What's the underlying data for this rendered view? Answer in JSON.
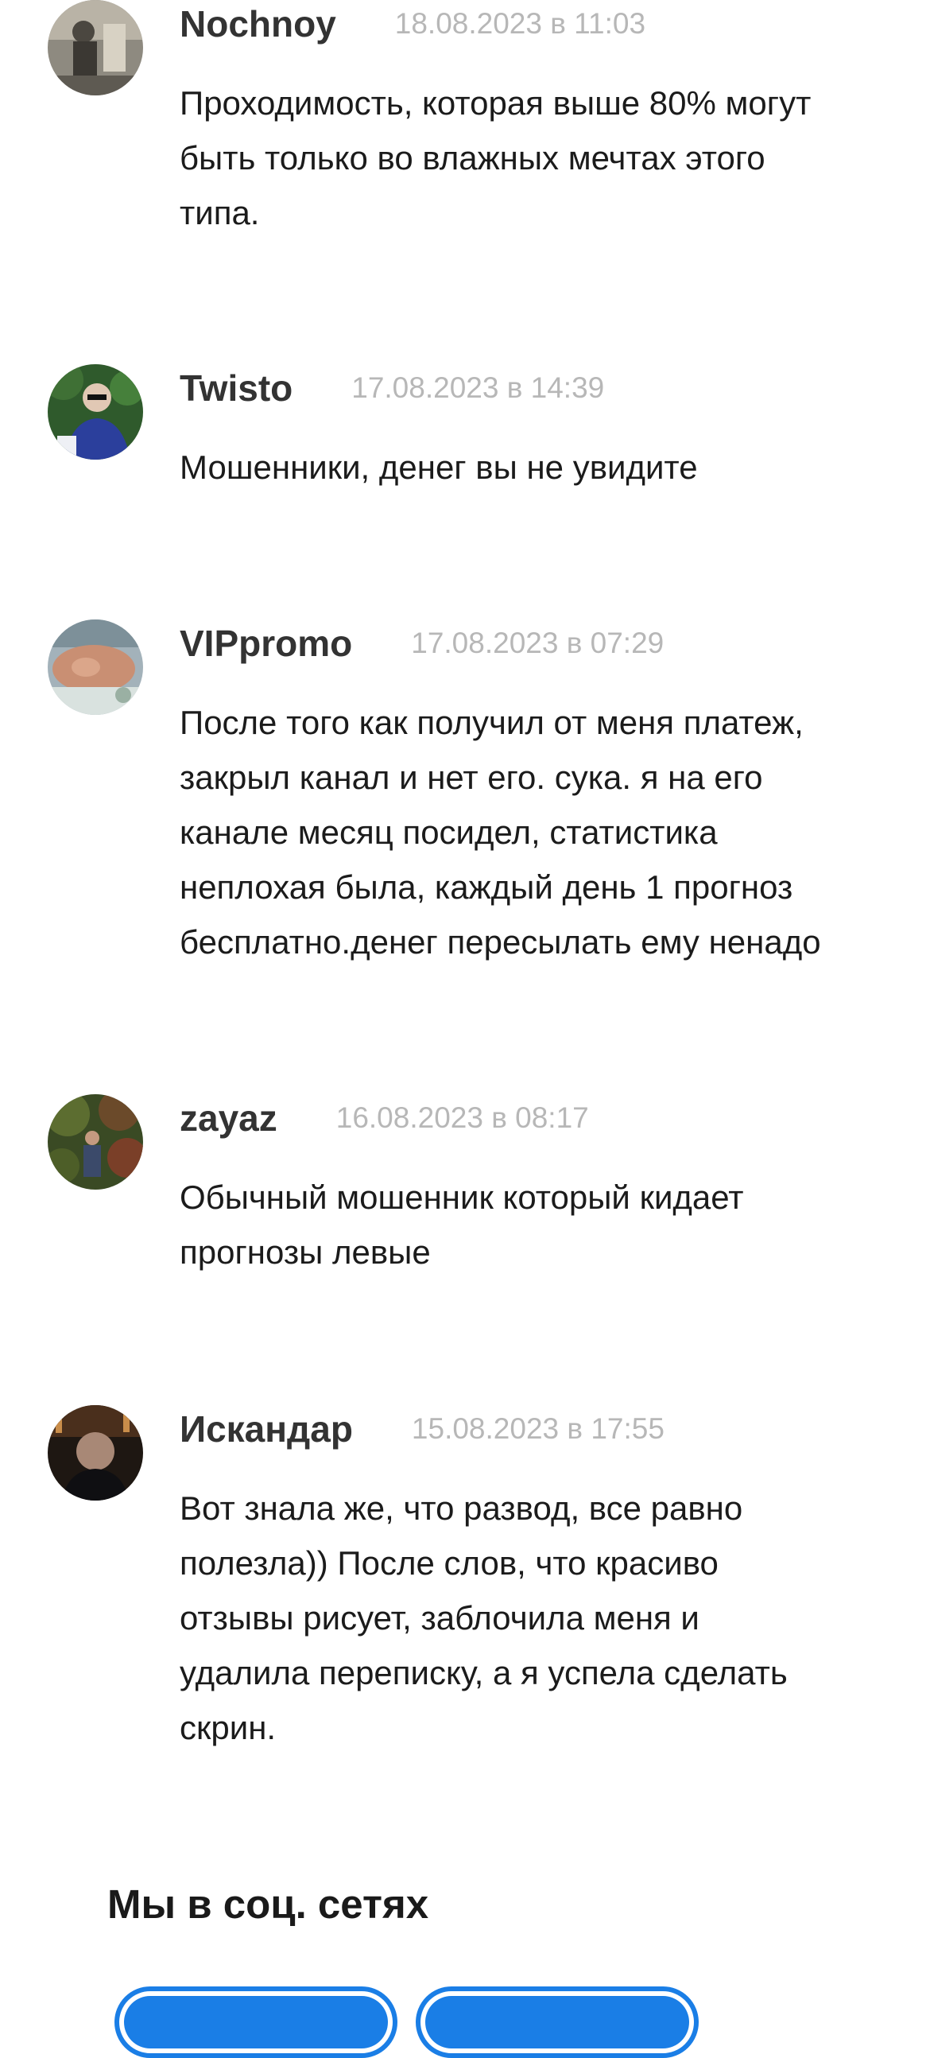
{
  "comments": [
    {
      "author": "Nochnoy",
      "date": "18.08.2023 в 11:03",
      "text": "Проходимость, которая выше 80% могут\nбыть только во влажных мечтах этого\nтипа."
    },
    {
      "author": "Twisto",
      "date": "17.08.2023 в 14:39",
      "text": "Мошенники, денег вы не увидите"
    },
    {
      "author": "VIPpromo",
      "date": "17.08.2023 в 07:29",
      "text": "После того как получил от меня платеж,\nзакрыл канал и нет его. сука. я на его\nканале месяц посидел, статистика\nнеплохая была, каждый день 1 прогноз\nбесплатно.денег пересылать ему ненадо"
    },
    {
      "author": "zayaz",
      "date": "16.08.2023 в 08:17",
      "text": "Обычный мошенник который кидает\nпрогнозы левые"
    },
    {
      "author": "Искандар",
      "date": "15.08.2023 в 17:55",
      "text": "Вот знала же, что развод, все равно\nполезла)) После слов, что красиво\nотзывы рисует, заблочила меня и\nудалила переписку, а я успела сделать\nскрин."
    }
  ],
  "social": {
    "title": "Мы в соц. сетях"
  },
  "colors": {
    "accent": "#1a7ee6",
    "author": "#333333",
    "date": "#b7b7b7"
  }
}
